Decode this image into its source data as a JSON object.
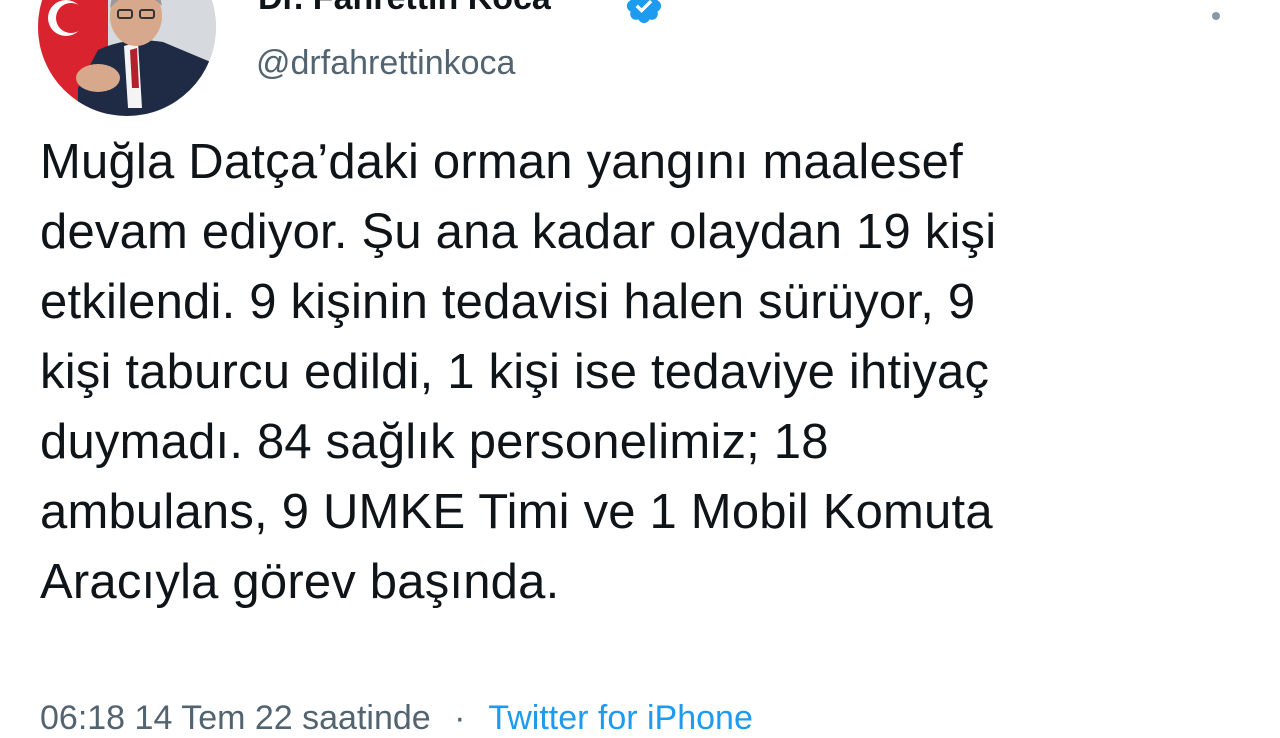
{
  "author": {
    "display_name": "Dr. Fahrettin Koca",
    "handle": "@drfahrettinkoca",
    "verified": true
  },
  "tweet": {
    "text_lines": [
      "Muğla Datça’daki orman yangını maalesef",
      "devam ediyor. Şu ana kadar olaydan 19 kişi",
      "etkilendi. 9 kişinin tedavisi halen sürüyor, 9",
      "kişi taburcu edildi, 1 kişi ise tedaviye ihtiyaç",
      "duymadı. 84 sağlık personelimiz; 18",
      "ambulans, 9 UMKE Timi ve 1 Mobil Komuta",
      "Aracıyla görev başında."
    ]
  },
  "meta": {
    "time": "06:18",
    "separator": "·",
    "date": "14 Tem 22 saatinde",
    "source": "Twitter for iPhone"
  },
  "icons": {
    "verified": "verified-badge-icon",
    "more": "more-options-icon"
  },
  "colors": {
    "verified_blue": "#1d9bf0",
    "text": "#0f1419",
    "secondary_text": "#536471"
  }
}
